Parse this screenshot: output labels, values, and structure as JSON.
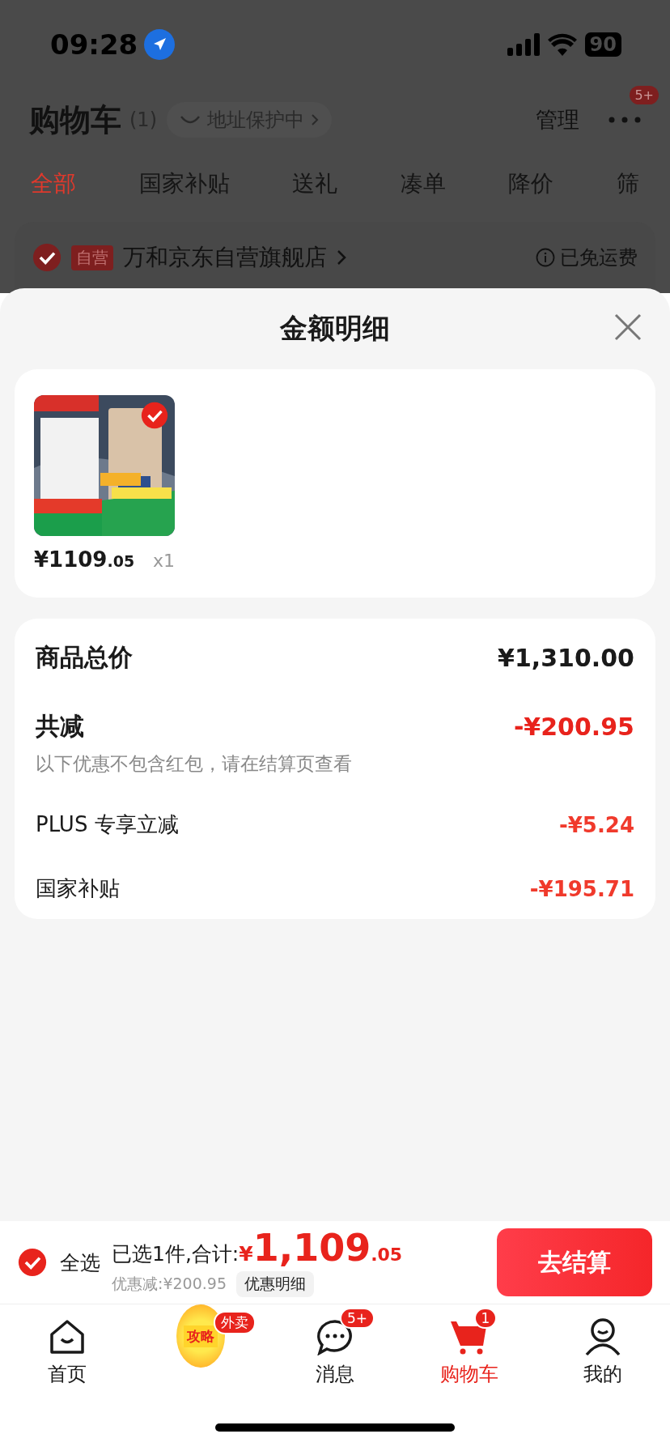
{
  "status_bar": {
    "time": "09:28",
    "battery": "90"
  },
  "header": {
    "title": "购物车",
    "count": "(1)",
    "address_badge": "地址保护中",
    "manage": "管理",
    "more_badge": "5+"
  },
  "tabs": [
    {
      "label": "全部",
      "selected": true
    },
    {
      "label": "国家补贴",
      "selected": false
    },
    {
      "label": "送礼",
      "selected": false
    },
    {
      "label": "凑单",
      "selected": false
    },
    {
      "label": "降价",
      "selected": false
    },
    {
      "label": "筛",
      "selected": false
    }
  ],
  "store": {
    "checked": true,
    "tag": "自营",
    "name": "万和京东自营旗舰店",
    "shipping": "已免运费"
  },
  "sheet": {
    "title": "金额明细",
    "product": {
      "kind": "picture",
      "checked": true,
      "price": "¥1109",
      "price_decimal": ".05",
      "quantity": "x1"
    },
    "summary": [
      {
        "kind": "total",
        "label": "商品总价",
        "value": "¥1,310.00"
      },
      {
        "kind": "discount",
        "label": "共减",
        "value": "-¥200.95",
        "note": "以下优惠不包含红包，请在结算页查看"
      },
      {
        "kind": "item",
        "label": "PLUS 专享立减",
        "value": "-¥5.24"
      },
      {
        "kind": "item",
        "label": "国家补贴",
        "value": "-¥195.71"
      }
    ]
  },
  "checkout_bar": {
    "select_all": {
      "label": "全选",
      "checked": true
    },
    "summary": "已选1件,合计:",
    "currency": "¥",
    "amount": "1,109",
    "amount_decimal": ".05",
    "discount": "优惠减:¥200.95",
    "details_button": "优惠明细",
    "checkout_button": "去结算"
  },
  "nav": [
    {
      "kind": "home",
      "label": "首页",
      "selected": false
    },
    {
      "kind": "promo",
      "label": "攻略",
      "badge": "外卖",
      "selected": false
    },
    {
      "kind": "message",
      "label": "消息",
      "badge": "5+",
      "selected": false
    },
    {
      "kind": "cart",
      "label": "购物车",
      "badge": "1",
      "selected": true
    },
    {
      "kind": "profile",
      "label": "我的",
      "selected": false
    }
  ]
}
